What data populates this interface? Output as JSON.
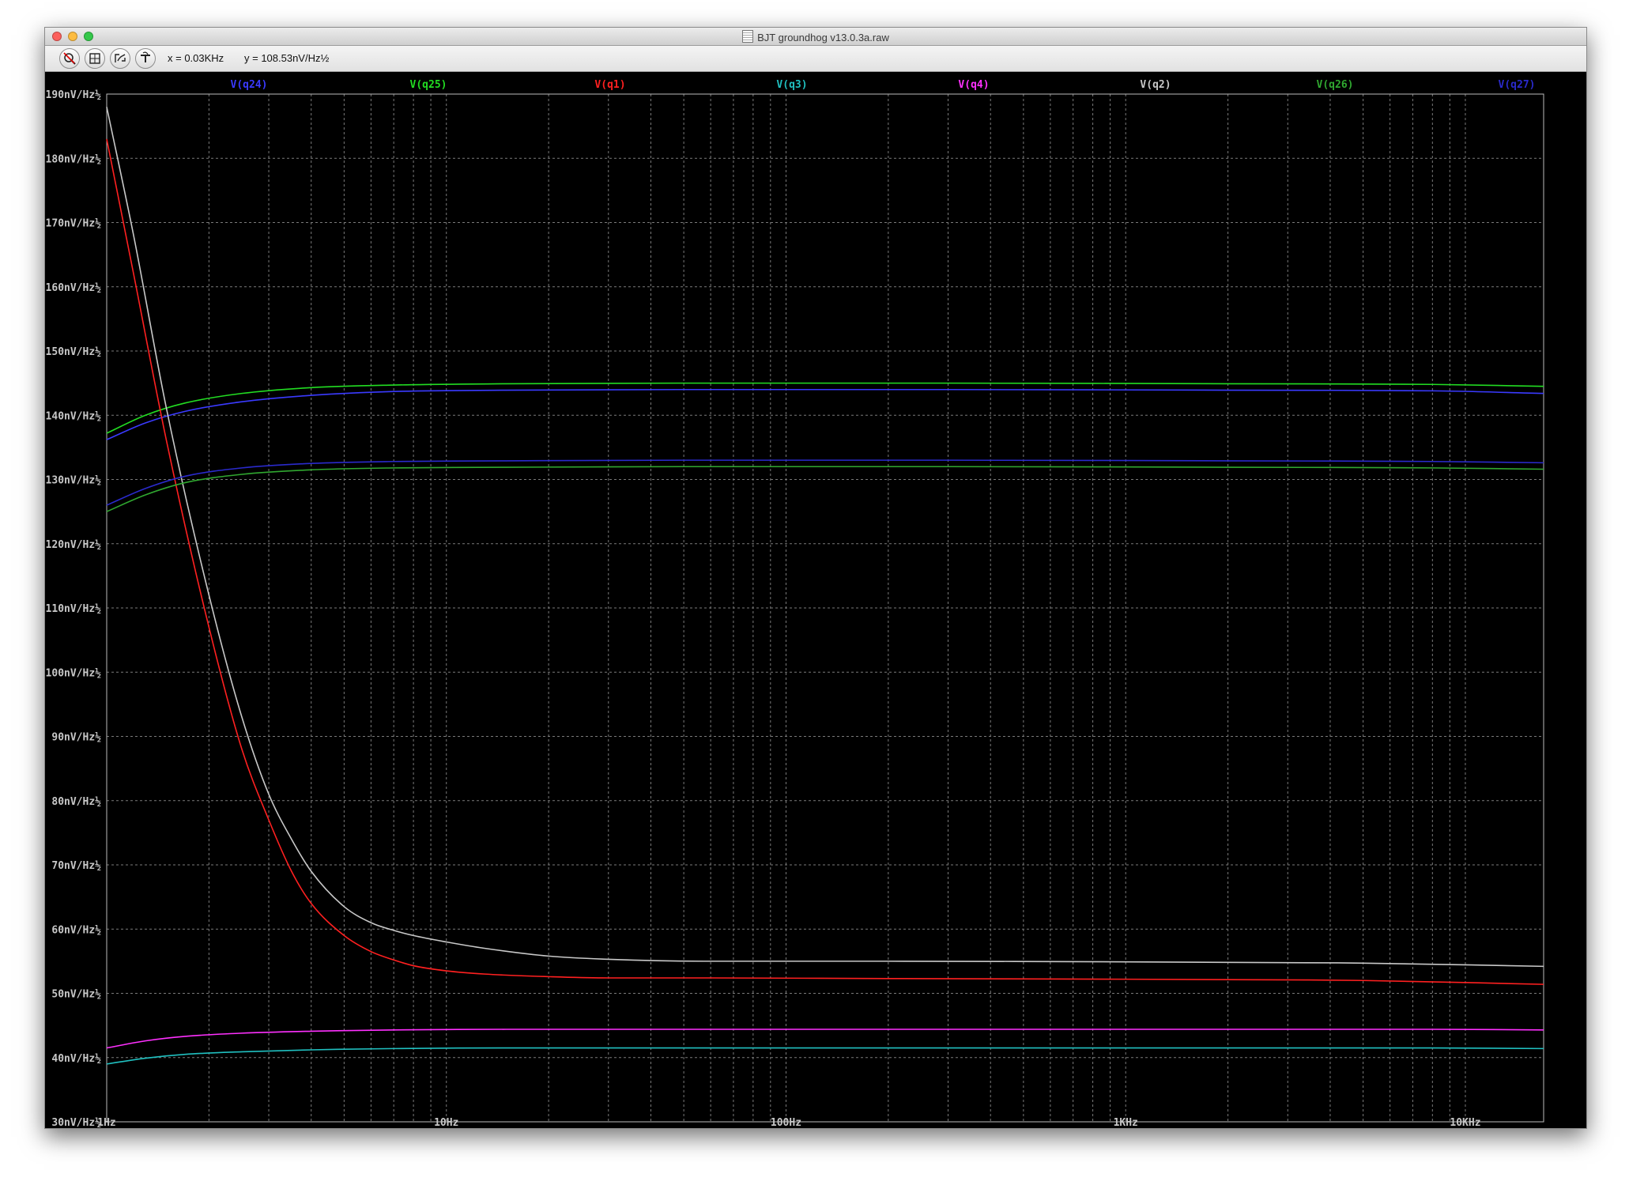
{
  "window": {
    "title": "BJT groundhog v13.0.3a.raw"
  },
  "toolbar": {
    "buttons": [
      {
        "name": "zoom-cancel-button",
        "icon": "zoom-cancel-icon"
      },
      {
        "name": "zoom-full-button",
        "icon": "zoom-fit-icon"
      },
      {
        "name": "zoom-back-button",
        "icon": "zoom-back-icon"
      },
      {
        "name": "probe-button",
        "icon": "probe-icon"
      }
    ],
    "cursor_x": "x = 0.03KHz",
    "cursor_y": "y = 108.53nV/Hz½"
  },
  "chart_data": {
    "type": "line",
    "x_scale": "log",
    "xlim": [
      1,
      17000
    ],
    "ylim": [
      30,
      190
    ],
    "grid": true,
    "x_ticks": [
      {
        "value": 1,
        "label": "1Hz"
      },
      {
        "value": 10,
        "label": "10Hz"
      },
      {
        "value": 100,
        "label": "100Hz"
      },
      {
        "value": 1000,
        "label": "1KHz"
      },
      {
        "value": 10000,
        "label": "10KHz"
      }
    ],
    "y_ticks": [
      {
        "value": 190,
        "label": "190nV/Hz½"
      },
      {
        "value": 180,
        "label": "180nV/Hz½"
      },
      {
        "value": 170,
        "label": "170nV/Hz½"
      },
      {
        "value": 160,
        "label": "160nV/Hz½"
      },
      {
        "value": 150,
        "label": "150nV/Hz½"
      },
      {
        "value": 140,
        "label": "140nV/Hz½"
      },
      {
        "value": 130,
        "label": "130nV/Hz½"
      },
      {
        "value": 120,
        "label": "120nV/Hz½"
      },
      {
        "value": 110,
        "label": "110nV/Hz½"
      },
      {
        "value": 100,
        "label": "100nV/Hz½"
      },
      {
        "value": 90,
        "label": "90nV/Hz½"
      },
      {
        "value": 80,
        "label": "80nV/Hz½"
      },
      {
        "value": 70,
        "label": "70nV/Hz½"
      },
      {
        "value": 60,
        "label": "60nV/Hz½"
      },
      {
        "value": 50,
        "label": "50nV/Hz½"
      },
      {
        "value": 40,
        "label": "40nV/Hz½"
      },
      {
        "value": 30,
        "label": "30nV/Hz½"
      }
    ],
    "series": [
      {
        "name": "V(q24)",
        "color": "#3a3aff",
        "x": [
          1,
          1.3,
          1.7,
          2.5,
          4,
          7,
          15,
          50,
          300,
          2000,
          8000,
          17000
        ],
        "y": [
          136.2,
          138.8,
          140.6,
          142.1,
          143.1,
          143.7,
          143.9,
          144.0,
          144.0,
          143.9,
          143.8,
          143.4
        ]
      },
      {
        "name": "V(q25)",
        "color": "#22dd22",
        "x": [
          1,
          1.3,
          1.7,
          2.5,
          4,
          7,
          15,
          50,
          300,
          2000,
          8000,
          17000
        ],
        "y": [
          137.2,
          140.0,
          141.9,
          143.4,
          144.3,
          144.7,
          144.9,
          145.0,
          145.0,
          144.9,
          144.8,
          144.5
        ]
      },
      {
        "name": "V(q1)",
        "color": "#ff2020",
        "x": [
          1,
          1.2,
          1.5,
          2,
          2.5,
          3,
          3.5,
          4,
          5,
          6,
          7,
          8,
          10,
          13,
          20,
          30,
          60,
          200,
          1000,
          5000,
          17000
        ],
        "y": [
          183,
          162,
          136,
          107,
          88,
          77,
          69,
          64,
          59,
          56.5,
          55.2,
          54.3,
          53.5,
          53.0,
          52.6,
          52.4,
          52.4,
          52.3,
          52.2,
          52.0,
          51.4
        ]
      },
      {
        "name": "V(q3)",
        "color": "#20c0c0",
        "x": [
          1,
          1.3,
          1.7,
          2.5,
          4,
          7,
          15,
          50,
          300,
          2000,
          8000,
          17000
        ],
        "y": [
          39.0,
          39.9,
          40.5,
          40.9,
          41.2,
          41.4,
          41.5,
          41.5,
          41.5,
          41.5,
          41.5,
          41.4
        ]
      },
      {
        "name": "V(q4)",
        "color": "#ff30ff",
        "x": [
          1,
          1.3,
          1.7,
          2.5,
          4,
          7,
          15,
          50,
          300,
          2000,
          8000,
          17000
        ],
        "y": [
          41.5,
          42.6,
          43.3,
          43.8,
          44.1,
          44.3,
          44.4,
          44.4,
          44.4,
          44.4,
          44.4,
          44.3
        ]
      },
      {
        "name": "V(q2)",
        "color": "#c8c8c8",
        "x": [
          1,
          1.2,
          1.5,
          2,
          2.5,
          3,
          3.5,
          4,
          5,
          6,
          7,
          8,
          10,
          13,
          20,
          30,
          60,
          200,
          1000,
          5000,
          17000
        ],
        "y": [
          188,
          168,
          141,
          112,
          93,
          81,
          74,
          69,
          63.5,
          61,
          59.8,
          59,
          58,
          57.0,
          55.8,
          55.3,
          55.0,
          55.0,
          54.9,
          54.7,
          54.2
        ]
      },
      {
        "name": "V(q26)",
        "color": "#30a830",
        "x": [
          1,
          1.3,
          1.7,
          2.5,
          4,
          7,
          15,
          50,
          300,
          2000,
          8000,
          17000
        ],
        "y": [
          125.0,
          127.6,
          129.5,
          130.8,
          131.5,
          131.8,
          131.9,
          132.0,
          132.0,
          131.9,
          131.8,
          131.6
        ]
      },
      {
        "name": "V(q27)",
        "color": "#2a2acc",
        "x": [
          1,
          1.3,
          1.7,
          2.5,
          4,
          7,
          15,
          50,
          300,
          2000,
          8000,
          17000
        ],
        "y": [
          126.0,
          128.6,
          130.5,
          131.8,
          132.5,
          132.8,
          132.9,
          133.0,
          133.0,
          132.9,
          132.8,
          132.6
        ]
      }
    ]
  }
}
